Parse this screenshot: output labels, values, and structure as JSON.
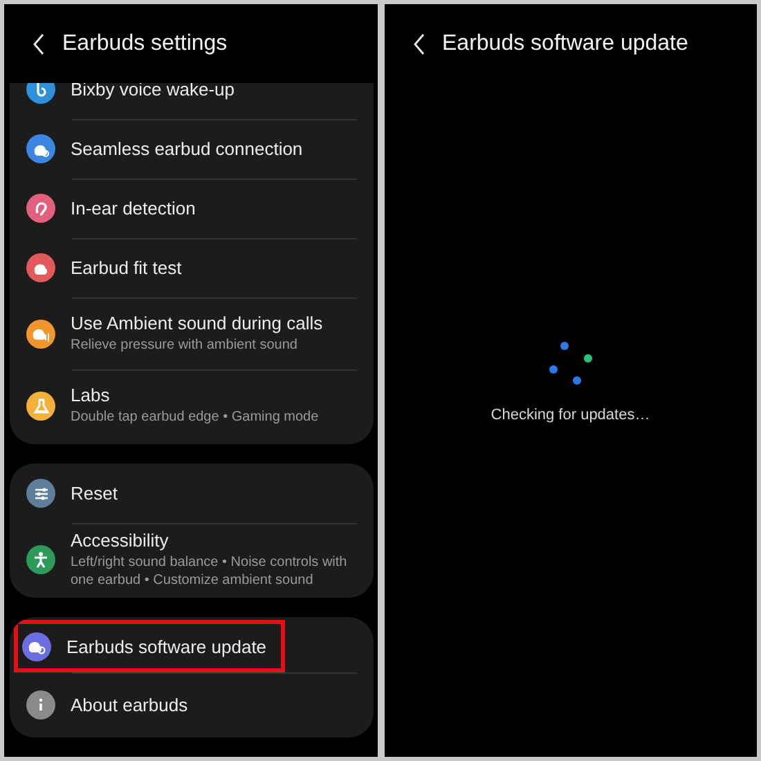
{
  "screens": [
    {
      "title": "Earbuds settings",
      "sections": [
        {
          "items": [
            {
              "label": "Bixby voice wake-up",
              "color": "#2f8fd8",
              "cut": true,
              "highlighted": false
            },
            {
              "label": "Seamless earbud connection",
              "color": "#3a86e0",
              "highlighted": false
            },
            {
              "label": "In-ear detection",
              "color": "#e0607e",
              "highlighted": false
            },
            {
              "label": "Earbud fit test",
              "color": "#e25a5a",
              "highlighted": false
            },
            {
              "label": "Use Ambient sound during calls",
              "subtitle": "Relieve pressure with ambient sound",
              "color": "#f0962a",
              "highlighted": false
            },
            {
              "label": "Labs",
              "subtitle": "Double tap earbud edge  •  Gaming mode",
              "color": "#f3b13c",
              "highlighted": false
            }
          ]
        },
        {
          "items": [
            {
              "label": "Reset",
              "color": "#5d7f9c",
              "highlighted": false
            },
            {
              "label": "Accessibility",
              "subtitle": "Left/right sound balance  •  Noise controls with one earbud  •  Customize ambient sound",
              "color": "#2e9a5a",
              "highlighted": false
            }
          ]
        },
        {
          "items": [
            {
              "label": "Earbuds software update",
              "color": "#6a6ee0",
              "highlighted": true
            },
            {
              "label": "About earbuds",
              "color": "#8a8a8a",
              "highlighted": false
            }
          ]
        }
      ]
    },
    {
      "title": "Earbuds software update",
      "status": "Checking for updates…"
    }
  ]
}
